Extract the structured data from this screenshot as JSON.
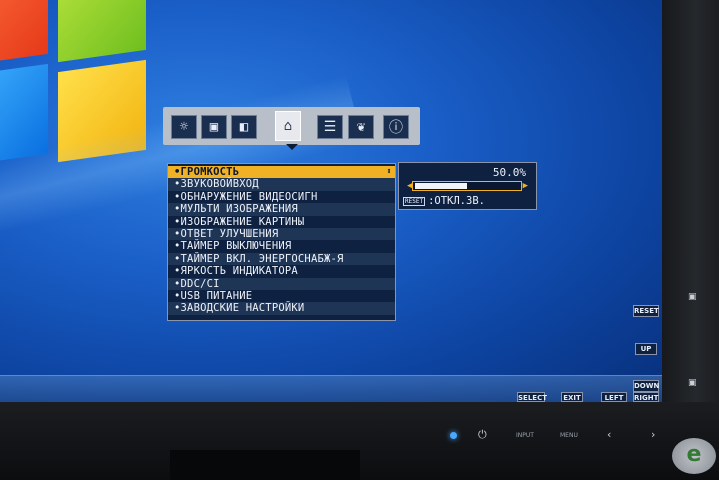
{
  "osd": {
    "tabs": [
      {
        "icon": "brightness-icon"
      },
      {
        "icon": "screen-adjust-icon"
      },
      {
        "icon": "color-icon"
      },
      {
        "icon": "toolbox-icon"
      },
      {
        "icon": "menu-tools-icon"
      },
      {
        "icon": "eco-icon"
      },
      {
        "icon": "information-icon"
      }
    ],
    "selected_tab": 3,
    "menu_items": [
      "•ГРОМКОСТЬ",
      "•ЗВУКОВОЙВХОД",
      "•ОБНАРУЖЕНИЕ ВИДЕОСИГН",
      "•МУЛЬТИ ИЗОБРАЖЕНИЯ",
      "•ИЗОБРАЖЕНИЕ КАРТИНЫ",
      "•ОТВЕТ УЛУЧШЕНИЯ",
      "•ТАЙМЕР ВЫКЛЮЧЕНИЯ",
      "•ТАЙМЕР ВКЛ. ЭНЕРГОСНАБЖ-Я",
      "•ЯРКОСТЬ ИНДИКАТОРА",
      "•DDC/CI",
      "•USB ПИТАНИЕ",
      "•ЗАВОДСКИЕ НАСТРОЙКИ"
    ],
    "selected_item": 0,
    "volume": {
      "value_text": "50.0%",
      "fraction": 0.5,
      "mute_key": "RESET",
      "mute_text": ":ОТКЛ.ЗВ."
    }
  },
  "hints": {
    "reset": "RESET",
    "up": "UP",
    "down": "DOWN",
    "right": "RIGHT",
    "select": "SELECT",
    "exit": "EXIT",
    "left": "LEFT"
  },
  "bezel": {
    "input": "INPUT",
    "menu": "MENU"
  },
  "watermark": "e"
}
